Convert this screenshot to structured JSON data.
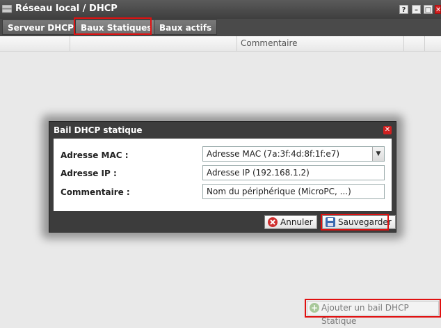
{
  "window": {
    "title": "Réseau local / DHCP",
    "help_label": "?",
    "minimize_label": "–",
    "maximize_label": "□",
    "close_label": "✕"
  },
  "tabs": [
    {
      "label": "Serveur DHCP"
    },
    {
      "label": "Baux Statiques",
      "active": true
    },
    {
      "label": "Baux actifs"
    }
  ],
  "grid": {
    "columns": [
      "",
      "",
      "Commentaire",
      "",
      ""
    ]
  },
  "dialog": {
    "title": "Bail DHCP statique",
    "close_label": "✕",
    "fields": {
      "mac_label": "Adresse MAC :",
      "mac_value": "Adresse MAC (7a:3f:4d:8f:1f:e7)",
      "ip_label": "Adresse IP :",
      "ip_value": "Adresse IP (192.168.1.2)",
      "comment_label": "Commentaire :",
      "comment_value": "Nom du périphérique (MicroPC, ...)"
    },
    "buttons": {
      "cancel": "Annuler",
      "save": "Sauvegarder"
    }
  },
  "footer": {
    "add_label": "Ajouter un bail DHCP Statique"
  },
  "colors": {
    "highlight": "#e01010",
    "titlebar": "#4a4a4a",
    "dialog_bg": "#3c3c3c"
  }
}
